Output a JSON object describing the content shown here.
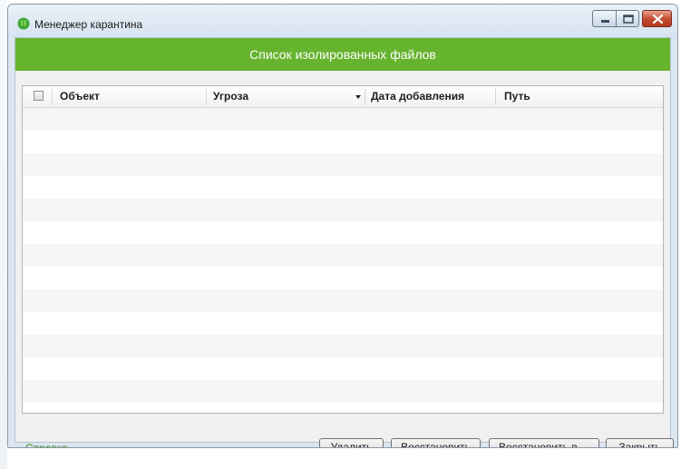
{
  "window": {
    "title": "Менеджер карантина"
  },
  "header": {
    "title": "Список изолированных файлов"
  },
  "table": {
    "columns": [
      "Объект",
      "Угроза",
      "Дата добавления",
      "Путь"
    ],
    "sorted_column": "Угроза",
    "rows": []
  },
  "footer": {
    "help_link": "Справка",
    "buttons": {
      "delete": "Удалить",
      "restore": "Восстановить",
      "restore_to": "Восстановить в ...",
      "close": "Закрыть"
    }
  },
  "colors": {
    "header_green": "#66b32e",
    "link_green": "#3c8a14",
    "close_red": "#c2482f"
  },
  "icons": {
    "app": "shield-icon",
    "minimize": "minimize-icon",
    "maximize": "maximize-icon",
    "close": "close-icon",
    "sort": "sort-down-icon"
  }
}
